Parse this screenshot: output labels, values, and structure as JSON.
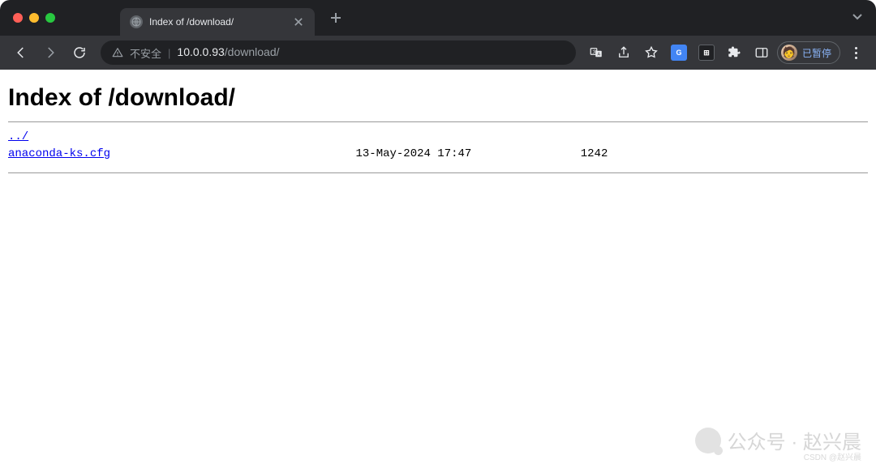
{
  "tab": {
    "title": "Index of /download/"
  },
  "toolbar": {
    "insecure_label": "不安全",
    "url_host": "10.0.0.93",
    "url_path": "/download/",
    "profile_label": "已暂停"
  },
  "page": {
    "heading": "Index of /download/",
    "parent_link": "../",
    "files": [
      {
        "name": "anaconda-ks.cfg",
        "date": "13-May-2024 17:47",
        "size": "1242"
      }
    ]
  },
  "watermark": {
    "main": "公众号 · 赵兴晨",
    "sub": "CSDN @赵兴晨"
  }
}
